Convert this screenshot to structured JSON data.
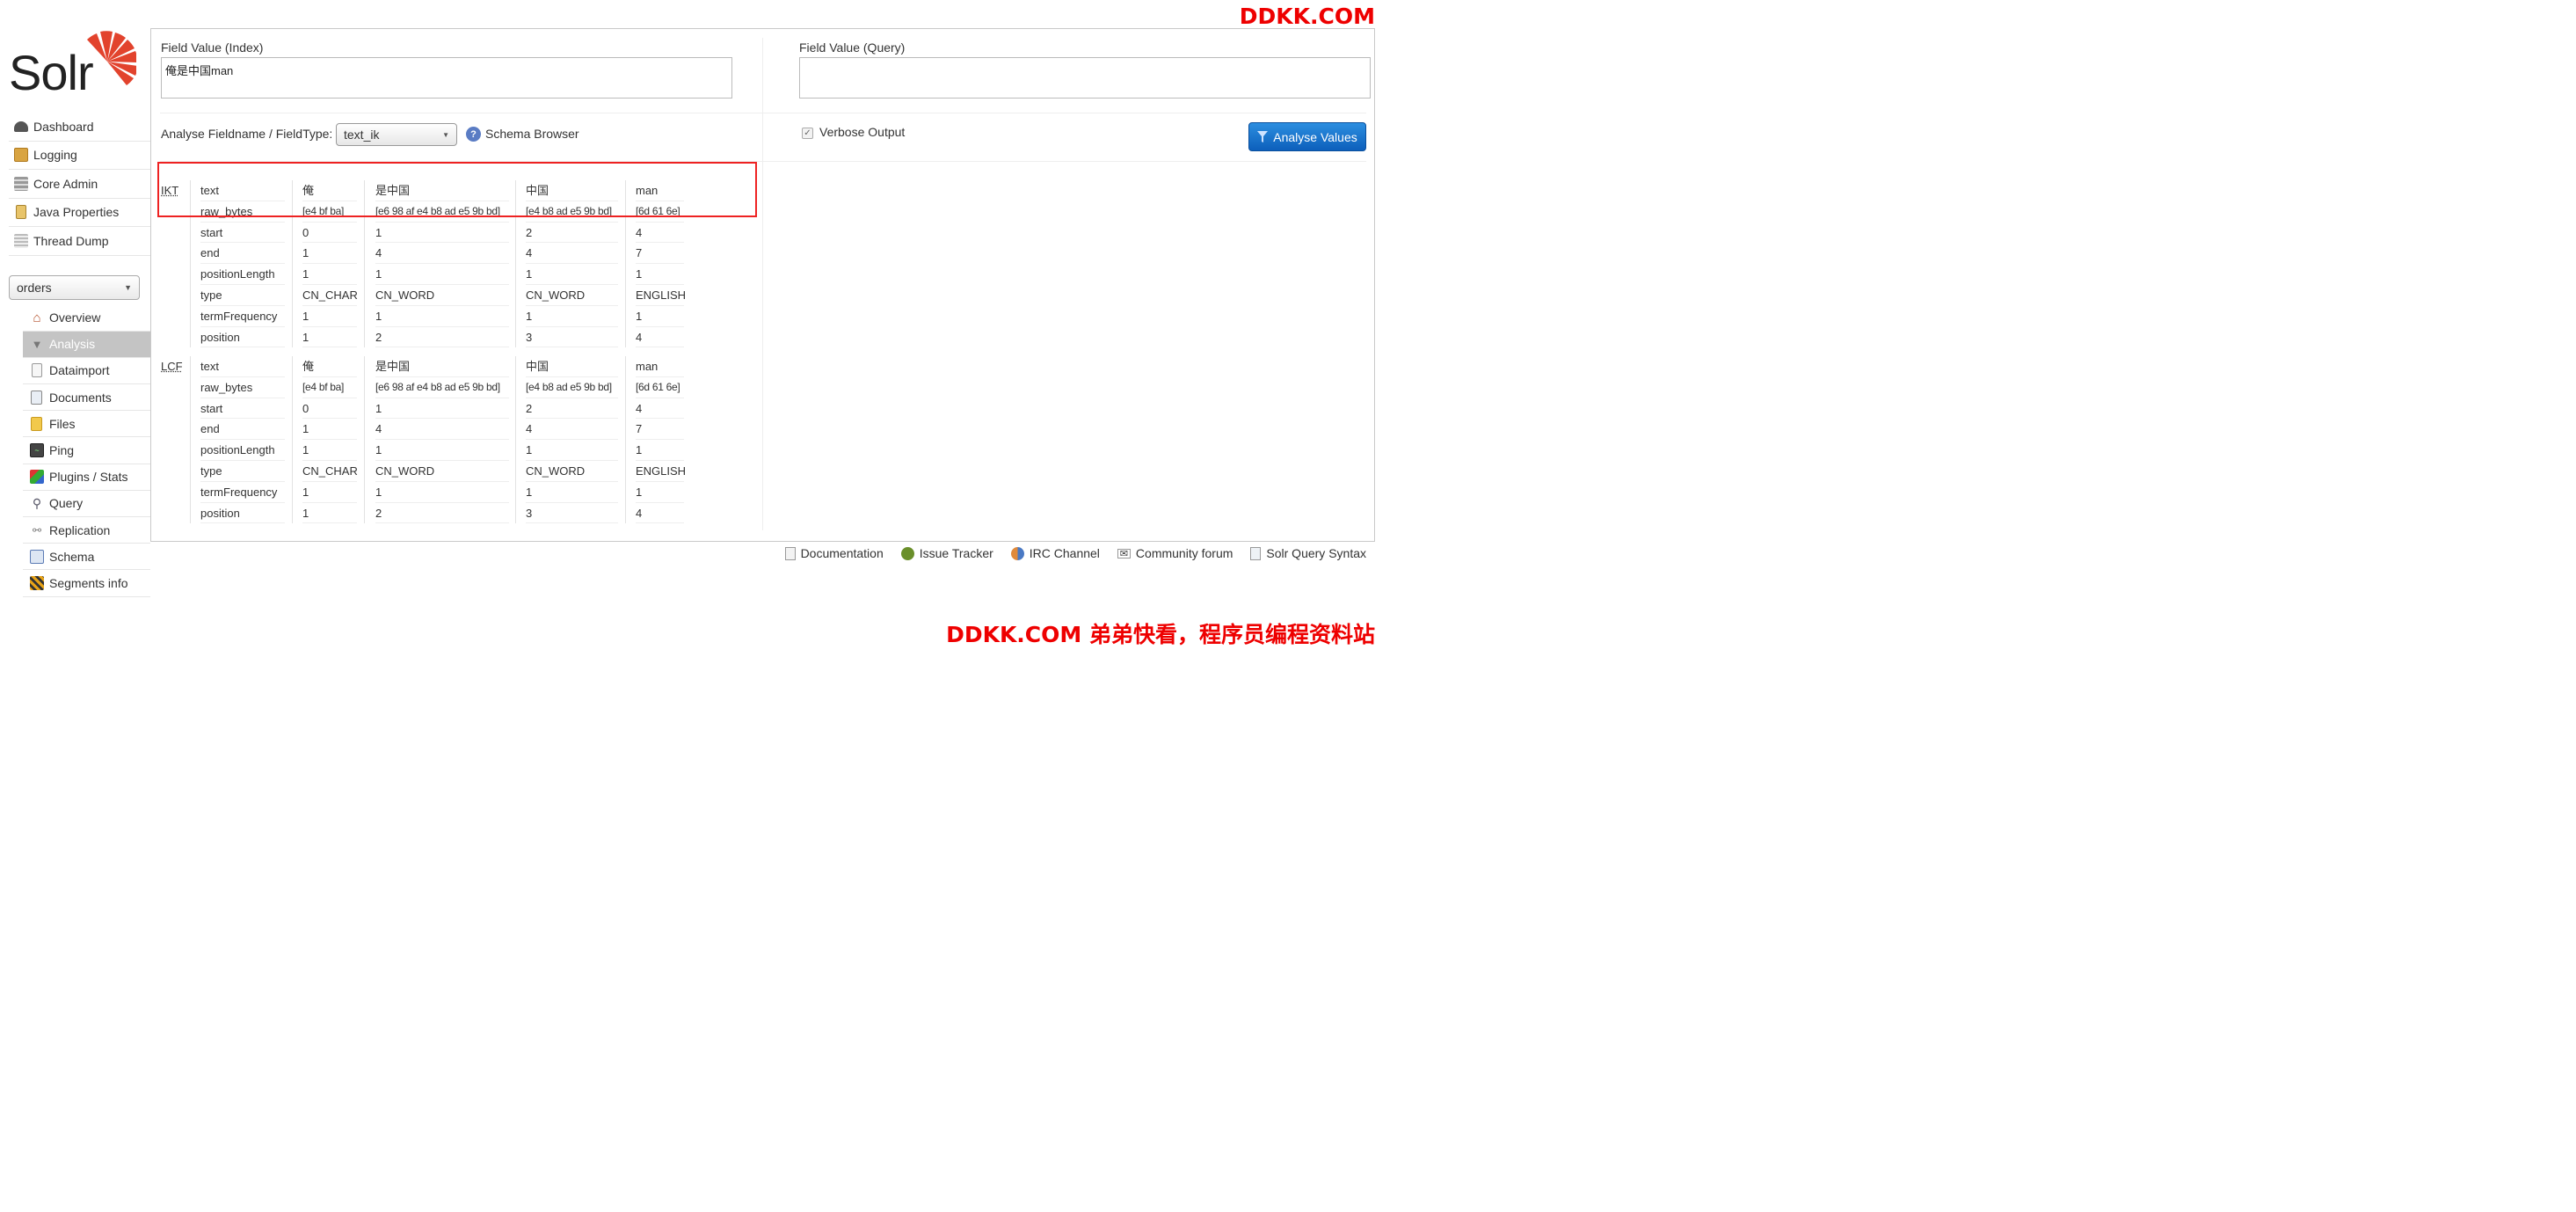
{
  "watermark": {
    "top": "DDKK.COM",
    "bottom": "DDKK.COM 弟弟快看，程序员编程资料站"
  },
  "logo": {
    "text": "Solr"
  },
  "nav": [
    {
      "label": "Dashboard",
      "icon": "dashboard-icon"
    },
    {
      "label": "Logging",
      "icon": "logging-icon"
    },
    {
      "label": "Core Admin",
      "icon": "core-admin-icon"
    },
    {
      "label": "Java Properties",
      "icon": "java-properties-icon"
    },
    {
      "label": "Thread Dump",
      "icon": "thread-dump-icon"
    }
  ],
  "core_selector": {
    "value": "orders"
  },
  "core_menu": [
    {
      "label": "Overview",
      "icon": "house-icon",
      "active": false
    },
    {
      "label": "Analysis",
      "icon": "funnel-icon",
      "active": true
    },
    {
      "label": "Dataimport",
      "icon": "dataimport-icon",
      "active": false
    },
    {
      "label": "Documents",
      "icon": "documents-icon",
      "active": false
    },
    {
      "label": "Files",
      "icon": "folder-icon",
      "active": false
    },
    {
      "label": "Ping",
      "icon": "ping-icon",
      "active": false
    },
    {
      "label": "Plugins / Stats",
      "icon": "plugins-icon",
      "active": false
    },
    {
      "label": "Query",
      "icon": "magnifier-icon",
      "active": false
    },
    {
      "label": "Replication",
      "icon": "replication-icon",
      "active": false
    },
    {
      "label": "Schema",
      "icon": "book-icon",
      "active": false
    },
    {
      "label": "Segments info",
      "icon": "segments-icon",
      "active": false
    }
  ],
  "form": {
    "field_value_index_label": "Field Value (Index)",
    "field_value_index": "俺是中国man",
    "field_value_query_label": "Field Value (Query)",
    "field_value_query": "",
    "fieldtype_label": "Analyse Fieldname / FieldType:",
    "fieldtype_value": "text_ik",
    "schema_browser": "Schema Browser",
    "verbose_label": "Verbose Output",
    "verbose_checked": true,
    "analyse_button": "Analyse Values"
  },
  "analysis": {
    "attributes": [
      "text",
      "raw_bytes",
      "start",
      "end",
      "positionLength",
      "type",
      "termFrequency",
      "position"
    ],
    "stages": [
      {
        "abbr": "IKT",
        "tokens": [
          [
            "俺",
            "[e4 bf ba]",
            "0",
            "1",
            "1",
            "CN_CHAR",
            "1",
            "1"
          ],
          [
            "是中国",
            "[e6 98 af e4 b8 ad e5 9b bd]",
            "1",
            "4",
            "1",
            "CN_WORD",
            "1",
            "2"
          ],
          [
            "中国",
            "[e4 b8 ad e5 9b bd]",
            "2",
            "4",
            "1",
            "CN_WORD",
            "1",
            "3"
          ],
          [
            "man",
            "[6d 61 6e]",
            "4",
            "7",
            "1",
            "ENGLISH",
            "1",
            "4"
          ]
        ]
      },
      {
        "abbr": "LCF",
        "tokens": [
          [
            "俺",
            "[e4 bf ba]",
            "0",
            "1",
            "1",
            "CN_CHAR",
            "1",
            "1"
          ],
          [
            "是中国",
            "[e6 98 af e4 b8 ad e5 9b bd]",
            "1",
            "4",
            "1",
            "CN_WORD",
            "1",
            "2"
          ],
          [
            "中国",
            "[e4 b8 ad e5 9b bd]",
            "2",
            "4",
            "1",
            "CN_WORD",
            "1",
            "3"
          ],
          [
            "man",
            "[6d 61 6e]",
            "4",
            "7",
            "1",
            "ENGLISH",
            "1",
            "4"
          ]
        ]
      }
    ]
  },
  "footer": [
    {
      "label": "Documentation",
      "icon": "documentation-icon"
    },
    {
      "label": "Issue Tracker",
      "icon": "bug-icon"
    },
    {
      "label": "IRC Channel",
      "icon": "irc-icon"
    },
    {
      "label": "Community forum",
      "icon": "mail-icon"
    },
    {
      "label": "Solr Query Syntax",
      "icon": "query-syntax-icon"
    }
  ],
  "colors": {
    "accent": "#1a73d0",
    "highlight_box": "#e22222",
    "watermark": "#ee0000",
    "active_menu": "#c4c4c4"
  }
}
